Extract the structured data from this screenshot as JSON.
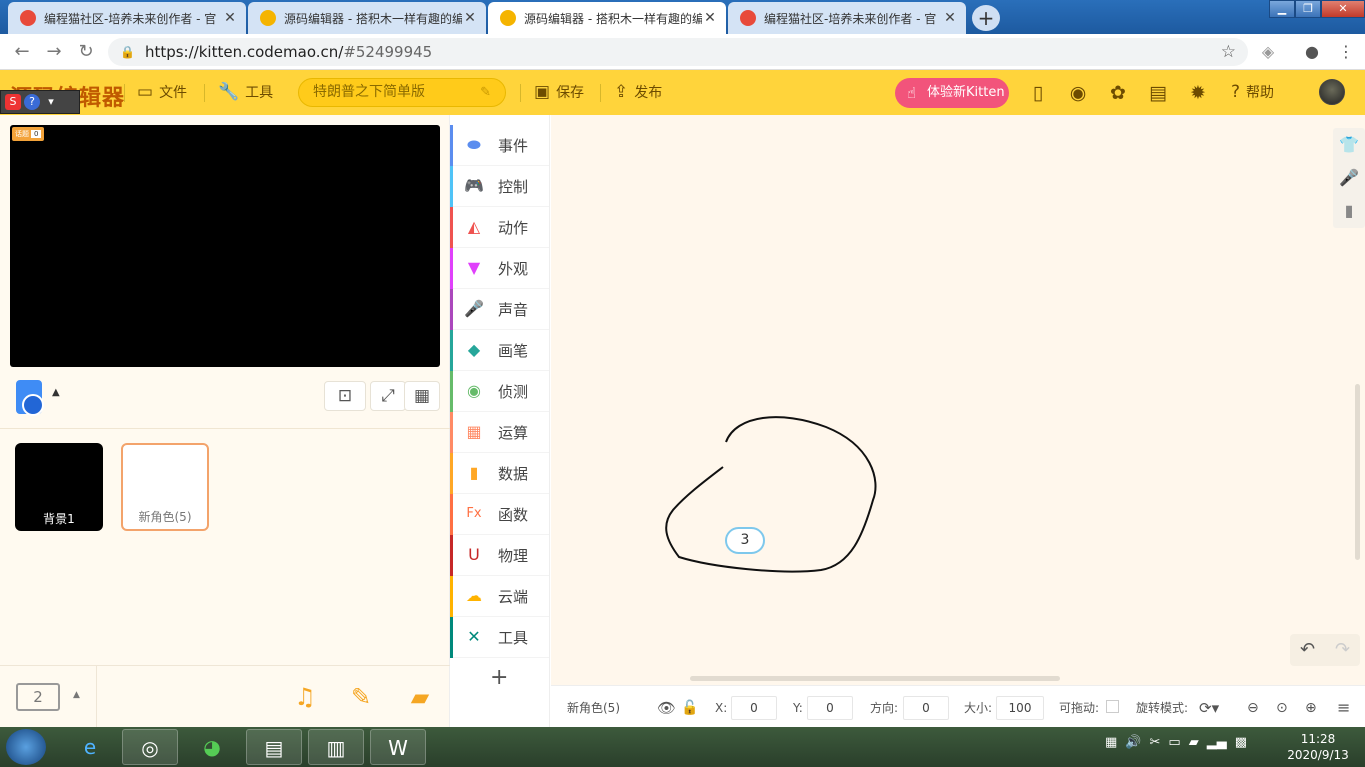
{
  "browser": {
    "tabs": [
      {
        "title": "编程猫社区-培养未来创作者 - 官",
        "active": false
      },
      {
        "title": "源码编辑器 - 搭积木一样有趣的编",
        "active": false
      },
      {
        "title": "源码编辑器 - 搭积木一样有趣的编",
        "active": true
      },
      {
        "title": "编程猫社区-培养未来创作者 - 官",
        "active": false
      }
    ],
    "close_glyph": "✕",
    "newtab_glyph": "+",
    "url_main": "https://kitten.codemao.cn/",
    "url_hash": "#52499945"
  },
  "header": {
    "logo": "源码编辑器",
    "file_label": "文件",
    "tools_label": "工具",
    "project_name": "特朗普之下简单版",
    "save_label": "保存",
    "publish_label": "发布",
    "try_kitten_label": "体验新Kitten",
    "help_label": "帮助"
  },
  "stage": {
    "var_label": "话题",
    "var_value": "0"
  },
  "sprites": [
    {
      "label": "背景1"
    },
    {
      "label": "新角色(5)"
    }
  ],
  "scene_count": "2",
  "categories": [
    {
      "label": "事件",
      "color": "#5b8def",
      "icon": "toggle-icon"
    },
    {
      "label": "控制",
      "color": "#4fc3f7",
      "icon": "gamepad-icon"
    },
    {
      "label": "动作",
      "color": "#ef5350",
      "icon": "ghost-icon"
    },
    {
      "label": "外观",
      "color": "#e040fb",
      "icon": "shirt-icon"
    },
    {
      "label": "声音",
      "color": "#ab47bc",
      "icon": "mic-icon"
    },
    {
      "label": "画笔",
      "color": "#26a69a",
      "icon": "pen-icon"
    },
    {
      "label": "侦测",
      "color": "#66bb6a",
      "icon": "target-icon"
    },
    {
      "label": "运算",
      "color": "#ff8a65",
      "icon": "calc-icon"
    },
    {
      "label": "数据",
      "color": "#ffa726",
      "icon": "bars-icon"
    },
    {
      "label": "函数",
      "color": "#ff7043",
      "icon": "fx-icon"
    },
    {
      "label": "物理",
      "color": "#c62828",
      "icon": "magnet-icon"
    },
    {
      "label": "云端",
      "color": "#ffb300",
      "icon": "cloud-icon"
    },
    {
      "label": "工具",
      "color": "#00897b",
      "icon": "wrench-icon"
    }
  ],
  "workspace": {
    "badge_value": "3"
  },
  "props": {
    "sprite_name": "新角色(5)",
    "x_label": "X:",
    "x_value": "0",
    "y_label": "Y:",
    "y_value": "0",
    "dir_label": "方向:",
    "dir_value": "0",
    "size_label": "大小:",
    "size_value": "100",
    "drag_label": "可拖动:",
    "rotate_label": "旋转模式:"
  },
  "taskbar": {
    "time": "11:28",
    "date": "2020/9/13"
  }
}
